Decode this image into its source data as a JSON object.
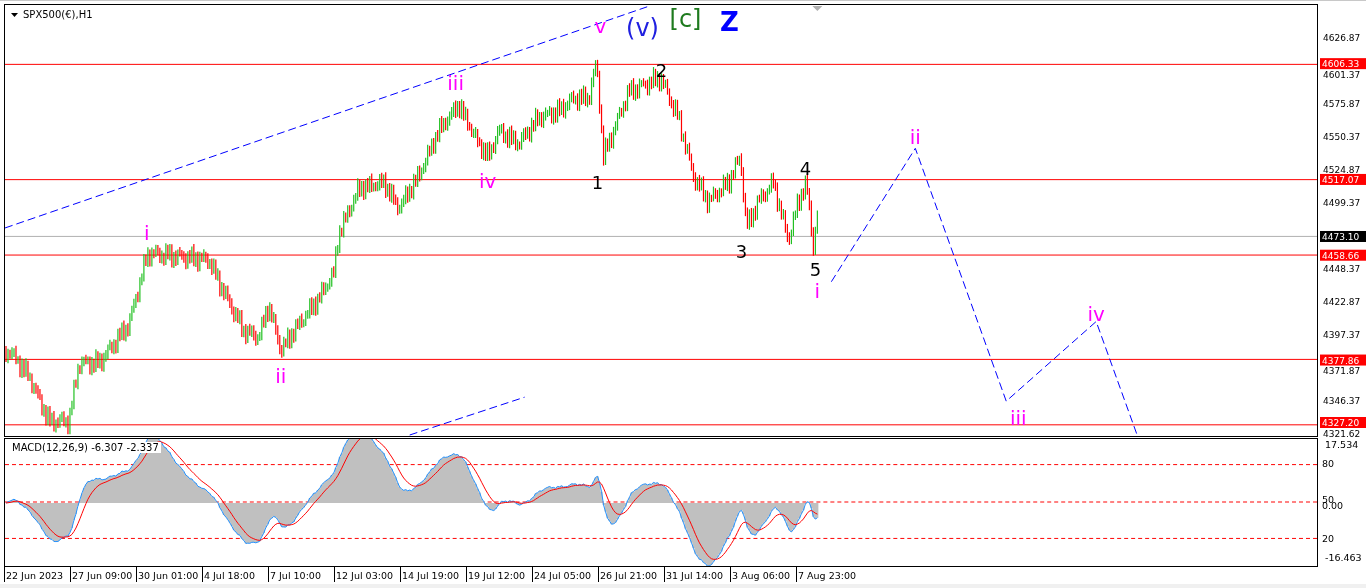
{
  "chart_header": {
    "symbol": "SPX500(€),H1"
  },
  "price_axis": {
    "ticks": [
      "4626.87",
      "4601.37",
      "4575.87",
      "4550.37",
      "4524.87",
      "4499.37",
      "4448.37",
      "4422.87",
      "4397.37",
      "4371.87",
      "4346.37",
      "4321.62"
    ]
  },
  "price_levels": [
    {
      "label": "4606.33",
      "kind": "level"
    },
    {
      "label": "4517.07",
      "kind": "level"
    },
    {
      "label": "4473.10",
      "kind": "current"
    },
    {
      "label": "4458.66",
      "kind": "level"
    },
    {
      "label": "4377.86",
      "kind": "level"
    },
    {
      "label": "4327.20",
      "kind": "level"
    }
  ],
  "wave_labels": [
    {
      "text": "v",
      "kind": "minute",
      "color": "#ff00ff"
    },
    {
      "text": "(v)",
      "kind": "minor",
      "color": "#2020e0"
    },
    {
      "text": "[c]",
      "kind": "intermediate",
      "color": "#1e7a1e"
    },
    {
      "text": "Z",
      "kind": "primary",
      "color": "#0000ff"
    },
    {
      "text": "iii",
      "kind": "minute",
      "color": "#ff00ff"
    },
    {
      "text": "2",
      "kind": "minuette",
      "color": "#000000"
    },
    {
      "text": "iv",
      "kind": "minute",
      "color": "#ff00ff"
    },
    {
      "text": "1",
      "kind": "minuette",
      "color": "#000000"
    },
    {
      "text": "4",
      "kind": "minuette",
      "color": "#000000"
    },
    {
      "text": "i",
      "kind": "minute",
      "color": "#ff00ff"
    },
    {
      "text": "3",
      "kind": "minuette",
      "color": "#000000"
    },
    {
      "text": "5",
      "kind": "minuette",
      "color": "#000000"
    },
    {
      "text": "i",
      "kind": "minute",
      "color": "#ff00ff"
    },
    {
      "text": "ii",
      "kind": "minute",
      "color": "#ff00ff"
    },
    {
      "text": "ii",
      "kind": "minute",
      "color": "#ff00ff"
    },
    {
      "text": "iv",
      "kind": "minute",
      "color": "#ff00ff"
    },
    {
      "text": "iii",
      "kind": "minute",
      "color": "#ff00ff"
    }
  ],
  "indicator": {
    "title": "MACD(12,26,9) -6.307 -2.337",
    "axis_labels": [
      "17.534",
      "80",
      "50",
      "0.00",
      "20",
      "-16.463"
    ]
  },
  "time_axis": {
    "labels": [
      "22 Jun 2023",
      "27 Jun 09:00",
      "30 Jun 01:00",
      "4 Jul 18:00",
      "7 Jul 10:00",
      "12 Jul 03:00",
      "14 Jul 19:00",
      "19 Jul 12:00",
      "24 Jul 05:00",
      "26 Jul 21:00",
      "31 Jul 14:00",
      "3 Aug 06:00",
      "7 Aug 23:00"
    ]
  }
}
